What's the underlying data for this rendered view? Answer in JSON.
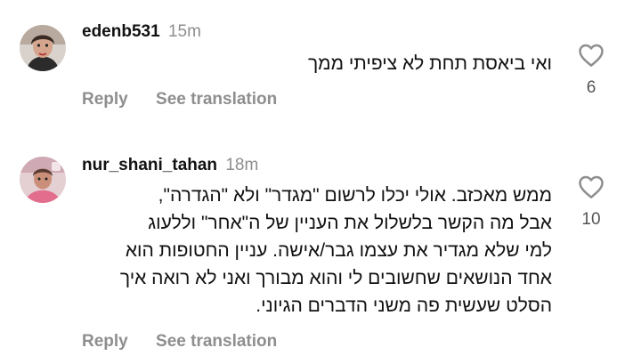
{
  "colors": {
    "username": "#111111",
    "meta": "#8e8e8e",
    "body": "#111111",
    "count": "#555555"
  },
  "comments": [
    {
      "username": "edenb531",
      "time": "15m",
      "lines": [
        "ואי ביאסת תחת לא ציפיתי ממך"
      ],
      "reply_label": "Reply",
      "translate_label": "See translation",
      "like_icon": "heart-outline-icon",
      "likes": "6"
    },
    {
      "username": "nur_shani_tahan",
      "time": "18m",
      "lines": [
        "ממש מאכזב. אולי יכלו לרשום \"מגדר\" ולא \"הגדרה\",",
        "אבל מה הקשר בלשלול את העניין של ה\"אחר\" וללעוג",
        "למי שלא מגדיר את עצמו גבר/אישה.  עניין החטופות הוא",
        "אחד הנושאים שחשובים לי והוא מבורך ואני לא רואה איך",
        "הסלט שעשית פה משני הדברים הגיוני."
      ],
      "reply_label": "Reply",
      "translate_label": "See translation",
      "like_icon": "heart-outline-icon",
      "likes": "10"
    }
  ]
}
